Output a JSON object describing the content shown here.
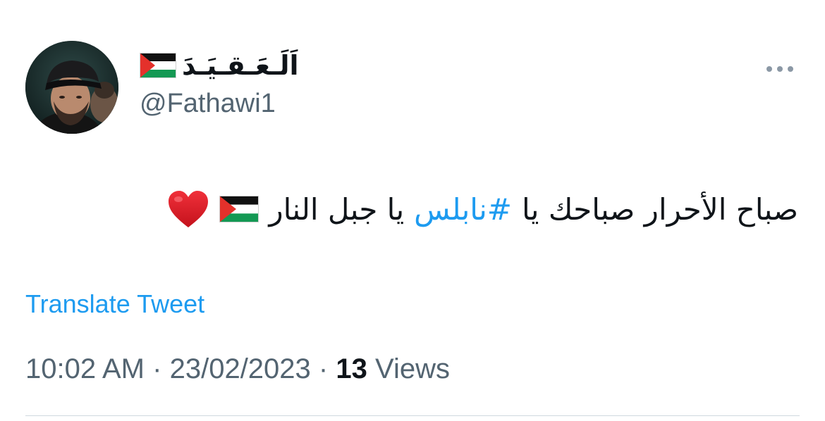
{
  "author": {
    "display_name": "اَلَـعَـقـيَـدَ",
    "display_name_flag": "palestine-flag",
    "handle": "@Fathawi1",
    "avatar": "profile-photo"
  },
  "tweet": {
    "text_part1": "صباح الأحرار صباحك يا",
    "hashtag": "#نابلس",
    "text_part2": "يا جبل النار",
    "trailing_emoji": [
      "palestine-flag",
      "red-heart"
    ]
  },
  "translate_label": "Translate Tweet",
  "meta": {
    "time": "10:02 AM",
    "separator": "·",
    "date": "23/02/2023",
    "views_count": "13",
    "views_label": "Views"
  },
  "colors": {
    "link": "#1d9bf0",
    "secondary_text": "#536471",
    "primary_text": "#0f1419"
  }
}
